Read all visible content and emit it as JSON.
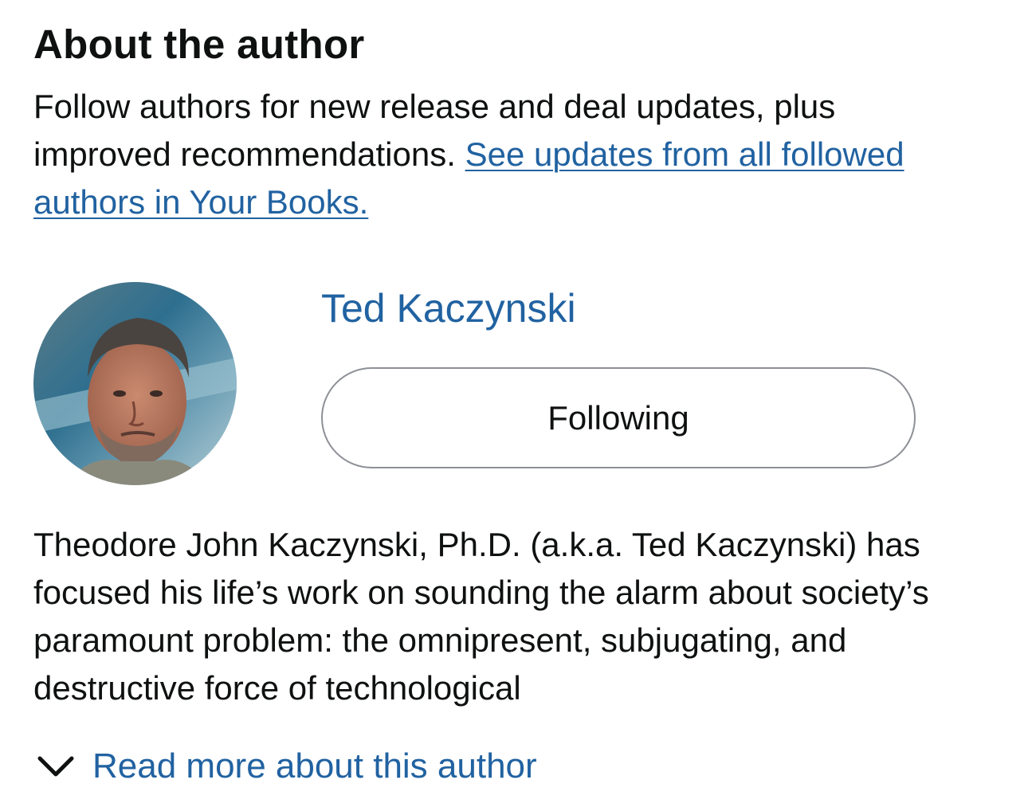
{
  "author_section": {
    "heading": "About the author",
    "intro_text": "Follow authors for new release and deal updates, plus improved recommendations.",
    "intro_link": "See updates from all followed authors in Your Books.",
    "author_name": "Ted Kaczynski",
    "follow_button_label": "Following",
    "bio": "Theodore John Kaczynski, Ph.D. (a.k.a. Ted Kaczynski) has focused his life’s work on sounding the alarm about society’s paramount problem: the omnipresent, subjugating, and destructive force of technological",
    "read_more_label": "Read more about this author",
    "read_more_icon": "chevron-down-icon",
    "colors": {
      "link": "#2162a1",
      "text": "#0f1111",
      "button_border": "#8d9096"
    }
  }
}
